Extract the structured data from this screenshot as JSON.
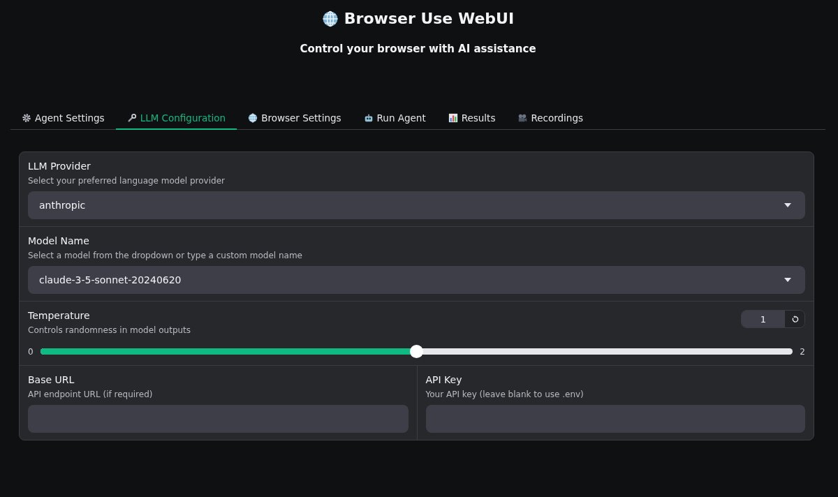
{
  "header": {
    "title": "Browser Use WebUI",
    "subtitle": "Control your browser with AI assistance"
  },
  "tabs": [
    {
      "label": "Agent Settings",
      "selected": false
    },
    {
      "label": "LLM Configuration",
      "selected": true
    },
    {
      "label": "Browser Settings",
      "selected": false
    },
    {
      "label": "Run Agent",
      "selected": false
    },
    {
      "label": "Results",
      "selected": false
    },
    {
      "label": "Recordings",
      "selected": false
    }
  ],
  "fields": [
    {
      "kind": "dropdown",
      "label": "LLM Provider",
      "info": "Select your preferred language model provider",
      "value": "anthropic"
    },
    {
      "kind": "dropdown",
      "label": "Model Name",
      "info": "Select a model from the dropdown or type a custom model name",
      "value": "claude-3-5-sonnet-20240620"
    },
    {
      "kind": "slider",
      "label": "Temperature",
      "info": "Controls randomness in model outputs",
      "value": "1",
      "min": "0",
      "max": "2",
      "level": 0.5
    },
    {
      "kind": "pair",
      "items": [
        {
          "label": "Base URL",
          "info": "API endpoint URL (if required)"
        },
        {
          "label": "API Key",
          "info": "Your API key (leave blank to use .env)"
        }
      ]
    }
  ]
}
